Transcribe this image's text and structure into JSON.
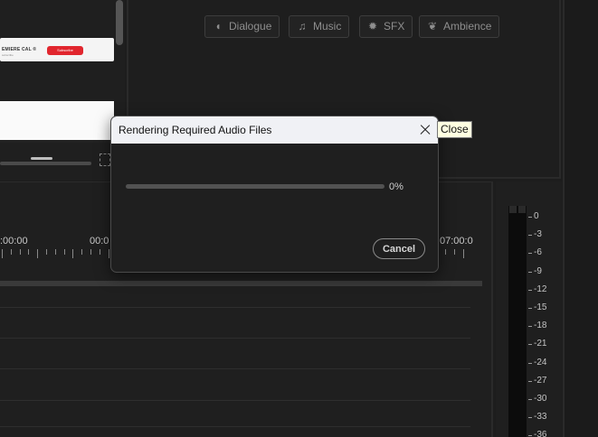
{
  "preview": {
    "card_title": "EMIERE CAL ®",
    "card_sub": "subscribe",
    "subscribe_label": "Subscribe"
  },
  "sound_types": [
    {
      "label": "Dialogue",
      "icon": "dialogue-icon",
      "glyph": "◖"
    },
    {
      "label": "Music",
      "icon": "music-note-icon",
      "glyph": "♫"
    },
    {
      "label": "SFX",
      "icon": "sfx-burst-icon",
      "glyph": "✹"
    },
    {
      "label": "Ambience",
      "icon": "ambience-icon",
      "glyph": "❦"
    }
  ],
  "timeline": {
    "timecodes": [
      ":00:00",
      "00:0",
      "07:00:0"
    ]
  },
  "meter": {
    "labels": [
      "0",
      "-3",
      "-6",
      "-9",
      "-12",
      "-15",
      "-18",
      "-21",
      "-24",
      "-27",
      "-30",
      "-33",
      "-36"
    ]
  },
  "dialog": {
    "title": "Rendering Required Audio Files",
    "progress": 0,
    "progress_label": "0%",
    "cancel_label": "Cancel",
    "close_tooltip": "Close"
  },
  "colors": {
    "accent": "#2d8ceb",
    "subscribe": "#e1262e"
  }
}
